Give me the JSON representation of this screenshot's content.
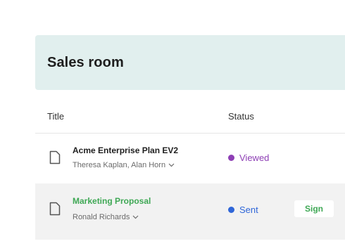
{
  "header": {
    "title": "Sales room"
  },
  "columns": {
    "title": "Title",
    "status": "Status"
  },
  "rows": [
    {
      "name": "Acme Enterprise Plan EV2",
      "people": "Theresa Kaplan, Alan Horn",
      "status": "Viewed",
      "status_color": "#8e3fb5",
      "icon": "document-icon"
    },
    {
      "name": "Marketing Proposal",
      "people": "Ronald Richards",
      "status": "Sent",
      "status_color": "#2f66d8",
      "action": "Sign",
      "icon": "document-icon"
    }
  ],
  "colors": {
    "header_bg": "#e1efee",
    "accent_green": "#3fa855"
  }
}
